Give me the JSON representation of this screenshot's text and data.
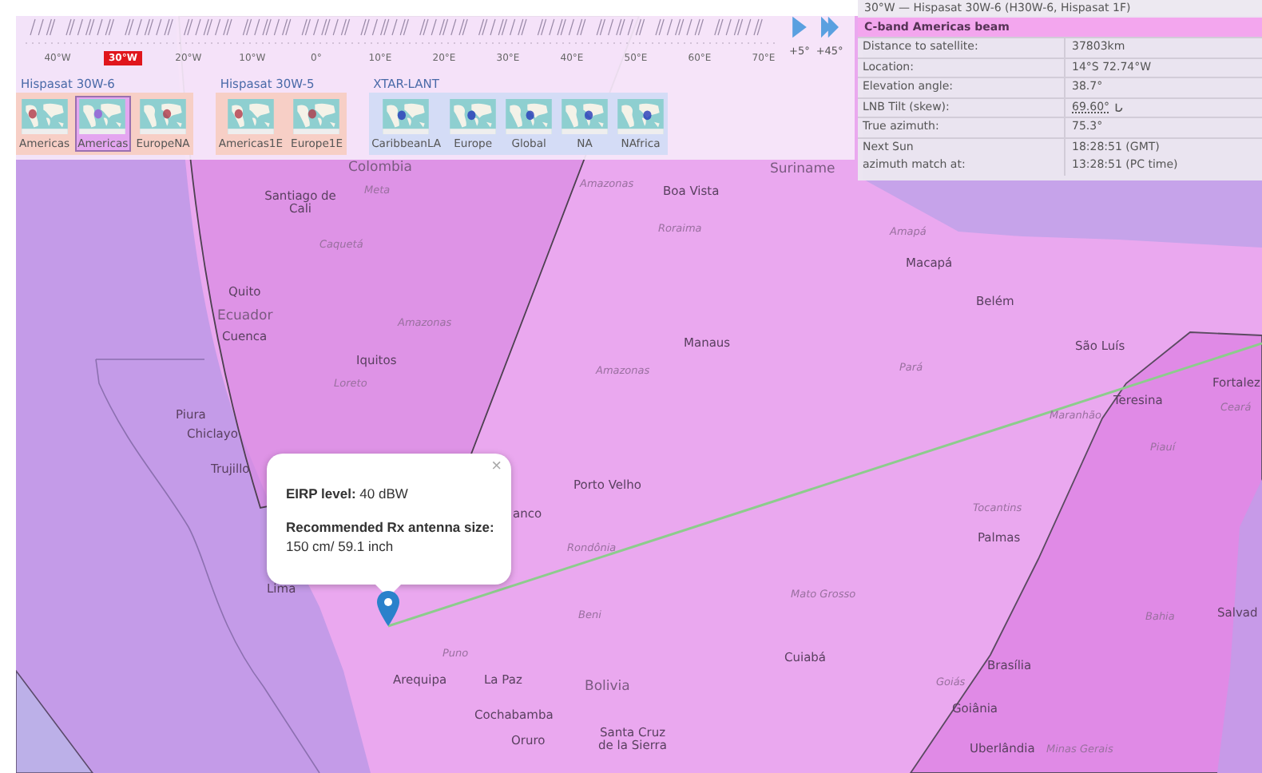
{
  "timeline": {
    "ticks": [
      {
        "label": "40°W",
        "selected": false
      },
      {
        "label": "30°W",
        "selected": true
      },
      {
        "label": "20°W",
        "selected": false
      },
      {
        "label": "10°W",
        "selected": false
      },
      {
        "label": "0°",
        "selected": false
      },
      {
        "label": "10°E",
        "selected": false
      },
      {
        "label": "20°E",
        "selected": false
      },
      {
        "label": "30°E",
        "selected": false
      },
      {
        "label": "40°E",
        "selected": false
      },
      {
        "label": "50°E",
        "selected": false
      },
      {
        "label": "60°E",
        "selected": false
      },
      {
        "label": "70°E",
        "selected": false
      }
    ],
    "steps": [
      "+5°",
      "+45°"
    ]
  },
  "satellites": [
    {
      "name": "Hispasat 30W-6",
      "kind": "hispasat",
      "beams": [
        {
          "label": "Americas",
          "selected": false
        },
        {
          "label": "Americas",
          "selected": true
        },
        {
          "label": "EuropeNA",
          "selected": false
        }
      ]
    },
    {
      "name": "Hispasat 30W-5",
      "kind": "hispasat",
      "beams": [
        {
          "label": "Americas1E",
          "selected": false
        },
        {
          "label": "Europe1E",
          "selected": false
        }
      ]
    },
    {
      "name": "XTAR-LANT",
      "kind": "xtar",
      "beams": [
        {
          "label": "CaribbeanLA",
          "selected": false
        },
        {
          "label": "Europe",
          "selected": false
        },
        {
          "label": "Global",
          "selected": false
        },
        {
          "label": "NA",
          "selected": false
        },
        {
          "label": "NAfrica",
          "selected": false
        }
      ]
    }
  ],
  "info_panel": {
    "title": "30°W — Hispasat 30W-6 (H30W-6, Hispasat 1F)",
    "beam": "C-band Americas beam",
    "rows": [
      {
        "label": "Distance to satellite:",
        "value": "37803km",
        "kind": "plain"
      },
      {
        "label": "Location:",
        "value": "14°S 72.74°W",
        "kind": "plain"
      },
      {
        "label": "Elevation angle:",
        "value": "38.7°",
        "kind": "plain"
      },
      {
        "label": "LNB Tilt (skew):",
        "value": "69.60°",
        "kind": "tilt"
      },
      {
        "label": "True azimuth:",
        "value": "75.3°",
        "kind": "plain"
      },
      {
        "label": "Next Sun",
        "value": "18:28:51 (GMT)",
        "kind": "plain"
      },
      {
        "label": "azimuth match at:",
        "value": "13:28:51 (PC time)",
        "kind": "joined"
      }
    ]
  },
  "popup": {
    "close": "×",
    "eirp": "**EIRP level:** 40 dBW",
    "antenna_label": "Recommended Rx antenna size:",
    "antenna_value": "150 cm/ 59.1 inch"
  },
  "map_labels": [
    {
      "text": "Colombia",
      "kind": "country"
    },
    {
      "text": "Suriname",
      "kind": "country"
    },
    {
      "text": "Santiago de Cali",
      "kind": "city"
    },
    {
      "text": "Meta",
      "kind": "region"
    },
    {
      "text": "Amazonas",
      "kind": "region"
    },
    {
      "text": "Boa Vista",
      "kind": "city"
    },
    {
      "text": "Roraima",
      "kind": "region"
    },
    {
      "text": "Amapá",
      "kind": "region"
    },
    {
      "text": "Caquetá",
      "kind": "region"
    },
    {
      "text": "Macapá",
      "kind": "city"
    },
    {
      "text": "Quito",
      "kind": "city"
    },
    {
      "text": "Belém",
      "kind": "city"
    },
    {
      "text": "Ecuador",
      "kind": "country"
    },
    {
      "text": "Amazonas",
      "kind": "region"
    },
    {
      "text": "Cuenca",
      "kind": "city"
    },
    {
      "text": "Manaus",
      "kind": "city"
    },
    {
      "text": "São Luís",
      "kind": "city"
    },
    {
      "text": "Iquitos",
      "kind": "city"
    },
    {
      "text": "Amazonas",
      "kind": "region"
    },
    {
      "text": "Pará",
      "kind": "region"
    },
    {
      "text": "Loreto",
      "kind": "region"
    },
    {
      "text": "Fortalez",
      "kind": "city"
    },
    {
      "text": "Teresina",
      "kind": "city"
    },
    {
      "text": "Piura",
      "kind": "city"
    },
    {
      "text": "Maranhão",
      "kind": "region"
    },
    {
      "text": "Ceará",
      "kind": "region"
    },
    {
      "text": "Chiclayo",
      "kind": "city"
    },
    {
      "text": "Piauí",
      "kind": "region"
    },
    {
      "text": "Trujillo",
      "kind": "city"
    },
    {
      "text": "Porto Velho",
      "kind": "city"
    },
    {
      "text": "anco",
      "kind": "city"
    },
    {
      "text": "Tocantins",
      "kind": "region"
    },
    {
      "text": "Rondônia",
      "kind": "region"
    },
    {
      "text": "Palmas",
      "kind": "city"
    },
    {
      "text": "Lima",
      "kind": "city"
    },
    {
      "text": "Mato Grosso",
      "kind": "region"
    },
    {
      "text": "Beni",
      "kind": "region"
    },
    {
      "text": "Bahia",
      "kind": "region"
    },
    {
      "text": "Salvad",
      "kind": "city"
    },
    {
      "text": "Puno",
      "kind": "region"
    },
    {
      "text": "Cuiabá",
      "kind": "city"
    },
    {
      "text": "Brasília",
      "kind": "city"
    },
    {
      "text": "Arequipa",
      "kind": "city"
    },
    {
      "text": "La Paz",
      "kind": "city"
    },
    {
      "text": "Bolivia",
      "kind": "country"
    },
    {
      "text": "Goiás",
      "kind": "region"
    },
    {
      "text": "Cochabamba",
      "kind": "city"
    },
    {
      "text": "Goiânia",
      "kind": "city"
    },
    {
      "text": "Oruro",
      "kind": "city"
    },
    {
      "text": "Santa Cruz de la Sierra",
      "kind": "city"
    },
    {
      "text": "Uberlândia",
      "kind": "city"
    },
    {
      "text": "Minas Gerais",
      "kind": "region"
    }
  ]
}
